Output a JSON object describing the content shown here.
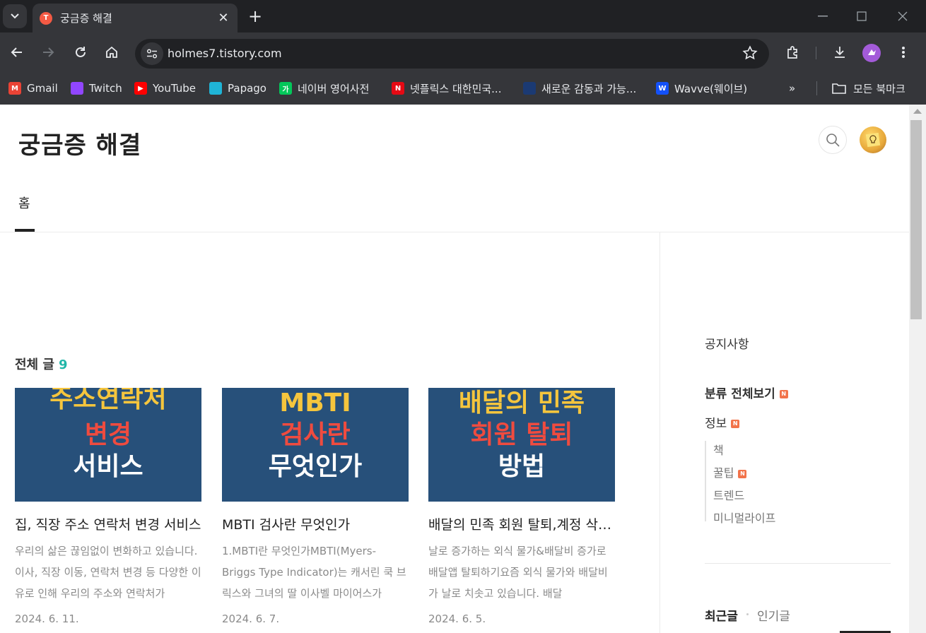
{
  "browser": {
    "tab": {
      "favicon_text": "T",
      "title": "궁금증 해결"
    },
    "url": "holmes7.tistory.com",
    "bookmarks": [
      {
        "label": "Gmail",
        "icon": "gmail-icon",
        "color": "#ea4335",
        "glyph": "M"
      },
      {
        "label": "Twitch",
        "icon": "twitch-icon",
        "color": "#9146ff",
        "glyph": ""
      },
      {
        "label": "YouTube",
        "icon": "youtube-icon",
        "color": "#ff0000",
        "glyph": "▶"
      },
      {
        "label": "Papago",
        "icon": "papago-icon",
        "color": "#1fb4d6",
        "glyph": ""
      },
      {
        "label": "네이버 영어사전",
        "icon": "naver-dict-icon",
        "color": "#03c75a",
        "glyph": "가"
      },
      {
        "label": "넷플릭스 대한민국...",
        "icon": "netflix-icon",
        "color": "#e50914",
        "glyph": "N"
      },
      {
        "label": "새로운 감동과 가능...",
        "icon": "disney-icon",
        "color": "#1b3a73",
        "glyph": ""
      },
      {
        "label": "Wavve(웨이브)",
        "icon": "wavve-icon",
        "color": "#1351f9",
        "glyph": "W"
      }
    ],
    "all_bookmarks": "모든 북마크"
  },
  "blog": {
    "title": "궁금증 해결",
    "nav_home": "홈",
    "list_label": "전체 글",
    "list_count": "9"
  },
  "posts": [
    {
      "thumb_lines": [
        "주소연락처",
        "변경",
        "서비스"
      ],
      "title": "집, 직장 주소 연락처 변경 서비스",
      "summary": "우리의 삶은 끊임없이 변화하고 있습니다. 이사, 직장 이동, 연락처 변경 등 다양한 이유로 인해 우리의 주소와 연락처가",
      "date": "2024. 6. 11."
    },
    {
      "thumb_lines": [
        "MBTI",
        "검사란",
        "무엇인가"
      ],
      "title": "MBTI 검사란 무엇인가",
      "summary": "1.MBTI란 무엇인가MBTI(Myers-Briggs Type Indicator)는 캐서린 쿡 브릭스와 그녀의 딸 이사벨 마이어스가",
      "date": "2024. 6. 7."
    },
    {
      "thumb_lines": [
        "배달의 민족",
        "회원 탈퇴",
        "방법"
      ],
      "title": "배달의 민족 회원 탈퇴,계정 삭제 방법",
      "summary": "날로 증가하는 외식 물가&배달비 증가로 배달앱 탈퇴하기요즘 외식 물가와 배달비가 날로 치솟고 있습니다. 배달",
      "date": "2024. 6. 5."
    }
  ],
  "thumb_colors": [
    "#f5c53d",
    "#ef4b3f",
    "#ffffff"
  ],
  "sidebar": {
    "notice": "공지사항",
    "all_categories": "분류 전체보기",
    "category": "정보",
    "subcategories": [
      "책",
      "꿀팁",
      "트렌드",
      "미니멀라이프"
    ],
    "recent": "최근글",
    "popular": "인기글",
    "new_badge": "N"
  }
}
